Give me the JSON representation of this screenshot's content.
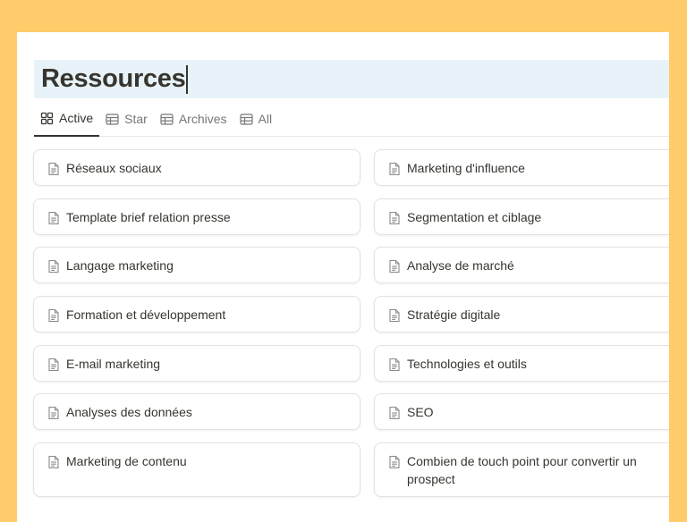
{
  "page": {
    "title": "Ressources",
    "background_color": "#FFCB6B",
    "title_highlight_color": "#E7F3F8"
  },
  "tabs": [
    {
      "label": "Active",
      "icon": "gallery-icon",
      "active": true
    },
    {
      "label": "Star",
      "icon": "table-icon",
      "active": false
    },
    {
      "label": "Archives",
      "icon": "table-icon",
      "active": false
    },
    {
      "label": "All",
      "icon": "table-icon",
      "active": false
    }
  ],
  "cards_left": [
    {
      "label": "Réseaux sociaux",
      "icon": "page-icon"
    },
    {
      "label": "Template brief relation presse",
      "icon": "page-icon"
    },
    {
      "label": "Langage marketing",
      "icon": "page-icon"
    },
    {
      "label": "Formation et développement",
      "icon": "page-icon"
    },
    {
      "label": "E-mail marketing",
      "icon": "page-icon"
    },
    {
      "label": "Analyses des données",
      "icon": "page-icon"
    },
    {
      "label": "Marketing de contenu",
      "icon": "page-icon"
    }
  ],
  "cards_right": [
    {
      "label": "Marketing d'influence",
      "icon": "page-icon"
    },
    {
      "label": "Segmentation et ciblage",
      "icon": "page-icon"
    },
    {
      "label": "Analyse de marché",
      "icon": "page-icon"
    },
    {
      "label": "Stratégie digitale",
      "icon": "page-icon"
    },
    {
      "label": "Technologies et outils",
      "icon": "page-icon"
    },
    {
      "label": "SEO",
      "icon": "page-icon"
    },
    {
      "label": "Combien de touch point pour convertir un prospect",
      "icon": "page-icon"
    }
  ]
}
